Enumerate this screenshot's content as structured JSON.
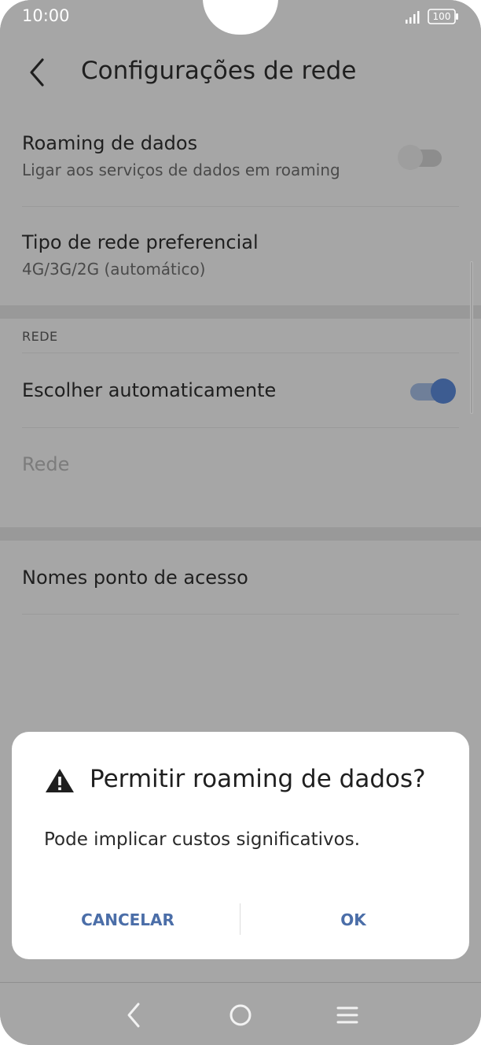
{
  "status_bar": {
    "time": "10:00",
    "battery": "100"
  },
  "header": {
    "title": "Configurações de rede"
  },
  "settings": {
    "data_roaming": {
      "title": "Roaming de dados",
      "subtitle": "Ligar aos serviços de dados em roaming",
      "enabled": false
    },
    "preferred_network": {
      "title": "Tipo de rede preferencial",
      "subtitle": "4G/3G/2G (automático)"
    },
    "network_section": {
      "header": "REDE"
    },
    "auto_select": {
      "title": "Escolher automaticamente",
      "enabled": true
    },
    "network": {
      "title": "Rede"
    },
    "apn": {
      "title": "Nomes ponto de acesso"
    }
  },
  "dialog": {
    "title": "Permitir roaming de dados?",
    "message": "Pode implicar custos significativos.",
    "cancel_label": "CANCELAR",
    "ok_label": "OK"
  },
  "colors": {
    "accent": "#4b6ea8",
    "scrim": "#a6a6a6"
  }
}
